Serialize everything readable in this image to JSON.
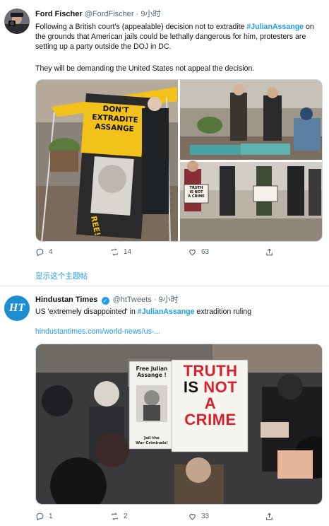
{
  "tweets": [
    {
      "name": "Ford Fischer",
      "handle": "@FordFischer",
      "separator": "·",
      "time": "9小时",
      "text_pre": "Following a British court's (appealable) decision not to extradite",
      "hashtag": "#JulianAssange",
      "text_post": "on the grounds that American jails could be lethally dangerous for him, protesters are setting up a party outside the DOJ in DC.",
      "text_2": "They will be demanding the United States not appeal the decision.",
      "media": {
        "sign_lines": [
          "DON'T",
          "EXTRADITE",
          "ASSANGE"
        ],
        "sign_bottom": "REE!",
        "sign2": [
          "TRUTH",
          "IS NOT",
          "A CRIME"
        ]
      },
      "actions": {
        "reply": "4",
        "retweet": "14",
        "like": "63"
      },
      "show_thread": "显示这个主题帖"
    },
    {
      "name": "Hindustan Times",
      "handle": "@htTweets",
      "separator": "·",
      "time": "9小时",
      "avatar_text": "HT",
      "text_pre": "US 'extremely disappointed' in",
      "hashtag": "#JulianAssange",
      "text_post": "extradition ruling",
      "link": "hindustantimes.com/world-news/us-...",
      "media": {
        "small_sign": [
          "Free Julian",
          "Assange !"
        ],
        "small_sign_bottom": [
          "Jail the",
          "War Criminals!"
        ],
        "big_sign": [
          "TRUTH",
          "IS",
          "NOT",
          "A",
          "CRIME"
        ]
      },
      "actions": {
        "reply": "1",
        "retweet": "2",
        "like": "33"
      }
    }
  ],
  "colors": {
    "accent": "#1d9bf0",
    "muted": "#536471",
    "border": "#cfd9de",
    "sign_red": "#d6232b",
    "banner_yellow": "#f3c21a"
  },
  "icons": [
    "reply-icon",
    "retweet-icon",
    "like-icon",
    "share-icon",
    "verified-icon"
  ]
}
